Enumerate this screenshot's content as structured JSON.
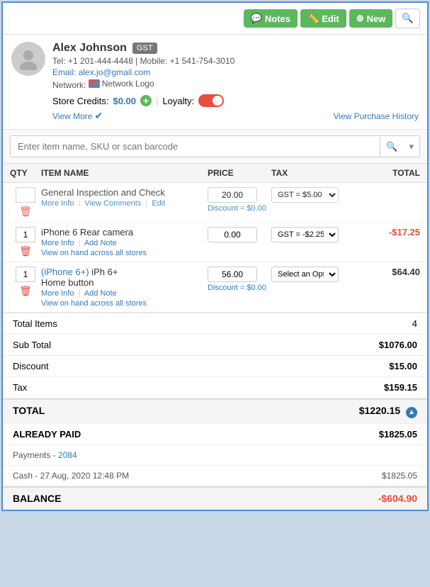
{
  "toolbar": {
    "notes_label": "Notes",
    "edit_label": "Edit",
    "new_label": "New"
  },
  "customer": {
    "name": "Alex Johnson",
    "badge": "GST",
    "tel": "Tel: +1 201-444-4448",
    "mobile": "Mobile: +1 541-754-3010",
    "email": "alex.jo@gmail.com",
    "network_label": "Network:",
    "store_credits_label": "Store Credits:",
    "store_credits_value": "$0.00",
    "loyalty_label": "Loyalty:",
    "view_more_label": "View More",
    "view_purchase_history_label": "View Purchase History"
  },
  "search": {
    "placeholder": "Enter item name, SKU or scan barcode"
  },
  "items_header": {
    "qty": "QTY",
    "item_name": "ITEM NAME",
    "price": "PRICE",
    "tax": "TAX",
    "total": "TOTAL"
  },
  "items": [
    {
      "qty": "",
      "name": "General Inspection and Check",
      "actions": [
        "More Info",
        "View Comments",
        "Edit"
      ],
      "price": "20.00",
      "discount": "Discount = $0.00",
      "tax": "GST = $5.00",
      "total": ""
    },
    {
      "qty": "1",
      "name": "iPhone 6 Rear camera",
      "subname": "",
      "actions": [
        "More Info",
        "Add Note"
      ],
      "extra_action": "View on hand across all stores",
      "price": "0.00",
      "discount": "",
      "tax": "GST = -$2.25",
      "total": "-$17.25"
    },
    {
      "qty": "1",
      "name": "(iPhone 6+) iPh 6+",
      "subname": "Home button",
      "actions": [
        "More Info",
        "Add Note"
      ],
      "extra_action": "View on hand across all stores",
      "price": "56.00",
      "discount": "Discount = $0.00",
      "tax": "Select an Opt...",
      "total": "$64.40"
    }
  ],
  "totals": {
    "total_items_label": "Total Items",
    "total_items_value": "4",
    "subtotal_label": "Sub Total",
    "subtotal_value": "$1076.00",
    "discount_label": "Discount",
    "discount_value": "$15.00",
    "tax_label": "Tax",
    "tax_value": "$159.15",
    "total_label": "TOTAL",
    "total_value": "$1220.15",
    "already_paid_label": "ALREADY PAID",
    "already_paid_value": "$1825.05",
    "payments_label": "Payments",
    "payments_ref": "2084",
    "payment_detail": "Cash - 27 Aug, 2020 12:48 PM",
    "payment_detail_value": "$1825.05",
    "balance_label": "BALANCE",
    "balance_value": "-$604.90"
  }
}
